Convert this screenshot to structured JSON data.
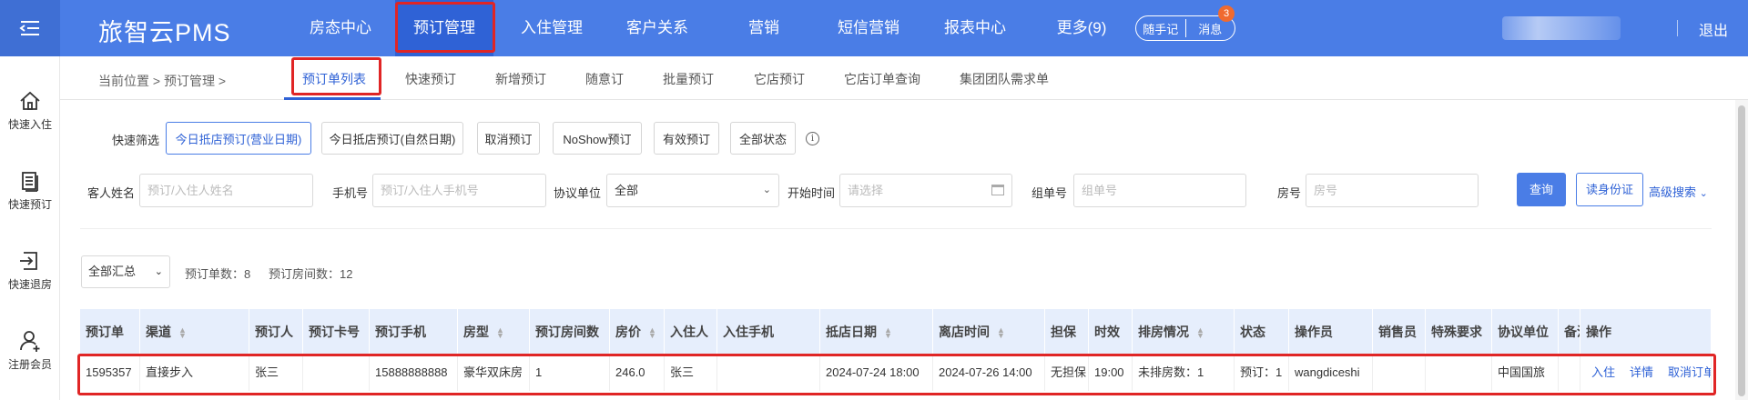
{
  "app": {
    "brand": "旅智云PMS",
    "logout": "退出"
  },
  "nav": [
    {
      "label": "房态中心",
      "active": false
    },
    {
      "label": "预订管理",
      "active": true
    },
    {
      "label": "入住管理",
      "active": false
    },
    {
      "label": "客户关系",
      "active": false
    },
    {
      "label": "营销",
      "active": false
    },
    {
      "label": "短信营销",
      "active": false
    },
    {
      "label": "报表中心",
      "active": false
    },
    {
      "label": "更多(9)",
      "active": false
    }
  ],
  "pill": {
    "memo": "随手记",
    "messages": "消息",
    "message_count": "3"
  },
  "sidebar": [
    {
      "label": "快速入住",
      "icon": "home-icon"
    },
    {
      "label": "快速预订",
      "icon": "document-icon"
    },
    {
      "label": "快速退房",
      "icon": "checkout-icon"
    },
    {
      "label": "注册会员",
      "icon": "user-add-icon"
    }
  ],
  "breadcrumb": {
    "text": "当前位置 > 预订管理 >"
  },
  "tabs": [
    {
      "label": "预订单列表",
      "active": true
    },
    {
      "label": "快速预订"
    },
    {
      "label": "新增预订"
    },
    {
      "label": "随意订"
    },
    {
      "label": "批量预订"
    },
    {
      "label": "它店预订"
    },
    {
      "label": "它店订单查询"
    },
    {
      "label": "集团团队需求单"
    }
  ],
  "quick_filter": {
    "label": "快速筛选",
    "buttons": [
      {
        "label": "今日抵店预订(营业日期)",
        "active": true
      },
      {
        "label": "今日抵店预订(自然日期)"
      },
      {
        "label": "取消预订"
      },
      {
        "label": "NoShow预订"
      },
      {
        "label": "有效预订"
      },
      {
        "label": "全部状态"
      }
    ]
  },
  "filters": {
    "guest_name": {
      "label": "客人姓名",
      "placeholder": "预订/入住人姓名"
    },
    "phone": {
      "label": "手机号",
      "placeholder": "预订/入住人手机号"
    },
    "agreement": {
      "label": "协议单位",
      "value": "全部"
    },
    "start_time": {
      "label": "开始时间",
      "placeholder": "请选择"
    },
    "group_no": {
      "label": "组单号",
      "placeholder": "组单号"
    },
    "room_no": {
      "label": "房号",
      "placeholder": "房号"
    },
    "search": "查询",
    "read_id": "读身份证",
    "advanced": "高级搜索"
  },
  "summary": {
    "select": "全部汇总",
    "order_count": "预订单数：8",
    "room_count": "预订房间数：12"
  },
  "table": {
    "columns": [
      "预订单",
      "渠道",
      "预订人",
      "预订卡号",
      "预订手机",
      "房型",
      "预订房间数",
      "房价",
      "入住人",
      "入住手机",
      "抵店日期",
      "离店时间",
      "担保",
      "时效",
      "排房情况",
      "状态",
      "操作员",
      "销售员",
      "特殊要求",
      "协议单位",
      "备注",
      "操作"
    ],
    "rows": [
      {
        "cells": [
          "1595357",
          "直接步入",
          "张三",
          "",
          "15888888888",
          "豪华双床房",
          "1",
          "246.0",
          "张三",
          "",
          "2024-07-24 18:00",
          "2024-07-26 14:00",
          "无担保",
          "19:00",
          "未排房数：1",
          "预订：1",
          "wangdiceshi",
          "",
          "",
          "中国国旅",
          ""
        ],
        "actions": [
          "入住",
          "详情",
          "取消订单"
        ]
      }
    ]
  },
  "colors": {
    "brand_blue": "#4a7de6",
    "active_blue": "#2f62d6",
    "highlight_red": "#e02525",
    "badge": "#f06a2f"
  }
}
